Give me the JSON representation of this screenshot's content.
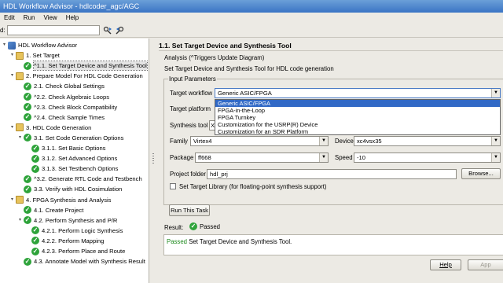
{
  "window": {
    "title": "HDL Workflow Advisor - hdlcoder_agc/AGC"
  },
  "menu": [
    "Edit",
    "Run",
    "View",
    "Help"
  ],
  "toolbar": {
    "find_label": "d:",
    "find_value": ""
  },
  "tree": [
    {
      "label": "HDL Workflow Advisor",
      "icon": "root",
      "level": 0,
      "expanded": true
    },
    {
      "label": "1. Set Target",
      "icon": "folder",
      "level": 1,
      "expanded": true
    },
    {
      "label": "^1.1. Set Target Device and Synthesis Tool",
      "icon": "check",
      "level": 2,
      "selected": true
    },
    {
      "label": "2. Prepare Model For HDL Code Generation",
      "icon": "folder",
      "level": 1,
      "expanded": true
    },
    {
      "label": "2.1. Check Global Settings",
      "icon": "check",
      "level": 2
    },
    {
      "label": "^2.2. Check Algebraic Loops",
      "icon": "check",
      "level": 2
    },
    {
      "label": "^2.3. Check Block Compatibility",
      "icon": "check",
      "level": 2
    },
    {
      "label": "^2.4. Check Sample Times",
      "icon": "check",
      "level": 2
    },
    {
      "label": "3. HDL Code Generation",
      "icon": "folder",
      "level": 1,
      "expanded": true
    },
    {
      "label": "3.1. Set Code Generation Options",
      "icon": "check",
      "level": 2,
      "expanded": true
    },
    {
      "label": "3.1.1. Set Basic Options",
      "icon": "check",
      "level": 3
    },
    {
      "label": "3.1.2. Set Advanced Options",
      "icon": "check",
      "level": 3
    },
    {
      "label": "3.1.3. Set Testbench Options",
      "icon": "check",
      "level": 3
    },
    {
      "label": "^3.2. Generate RTL Code and Testbench",
      "icon": "check",
      "level": 2
    },
    {
      "label": "3.3. Verify with HDL Cosimulation",
      "icon": "check",
      "level": 2
    },
    {
      "label": "4. FPGA Synthesis and Analysis",
      "icon": "folder",
      "level": 1,
      "expanded": true
    },
    {
      "label": "4.1. Create Project",
      "icon": "check",
      "level": 2
    },
    {
      "label": "4.2. Perform Synthesis and P/R",
      "icon": "check",
      "level": 2,
      "expanded": true
    },
    {
      "label": "4.2.1. Perform Logic Synthesis",
      "icon": "check",
      "level": 3
    },
    {
      "label": "4.2.2. Perform Mapping",
      "icon": "check",
      "level": 3
    },
    {
      "label": "4.2.3. Perform Place and Route",
      "icon": "check",
      "level": 3
    },
    {
      "label": "4.3. Annotate Model with Synthesis Result",
      "icon": "check",
      "level": 2
    }
  ],
  "panel": {
    "heading": "1.1. Set Target Device and Synthesis Tool",
    "analysis": "Analysis (^Triggers Update Diagram)",
    "description": "Set Target Device and Synthesis Tool for HDL code generation",
    "group_title": "Input Parameters",
    "target_workflow_label": "Target workflow",
    "target_workflow_value": "Generic ASIC/FPGA",
    "workflow_options": [
      "Generic ASIC/FPGA",
      "FPGA-in-the-Loop",
      "FPGA Turnkey",
      "Customization for the USRP(R) Device",
      "Customization for an SDR Platform"
    ],
    "target_platform_label": "Target platform",
    "synthesis_tool_label": "Synthesis tool",
    "synthesis_tool_value": "X",
    "family_label": "Family",
    "family_value": "Virtex4",
    "device_label": "Device",
    "device_value": "xc4vsx35",
    "package_label": "Package",
    "package_value": "ff668",
    "speed_label": "Speed",
    "speed_value": "-10",
    "project_folder_label": "Project folder",
    "project_folder_value": "hdl_prj",
    "browse_label": "Browse...",
    "target_library_label": "Set Target Library (for floating-point synthesis support)",
    "run_button": "Run This Task",
    "result_label": "Result:",
    "result_value": "Passed",
    "result_message_status": "Passed",
    "result_message": "Set Target Device and Synthesis Tool.",
    "help_button": "Help",
    "apply_button": "App"
  },
  "colors": {
    "title_bar": "#3a74c4",
    "pass_green": "#2ea33a",
    "selection_blue": "#3169c6"
  }
}
